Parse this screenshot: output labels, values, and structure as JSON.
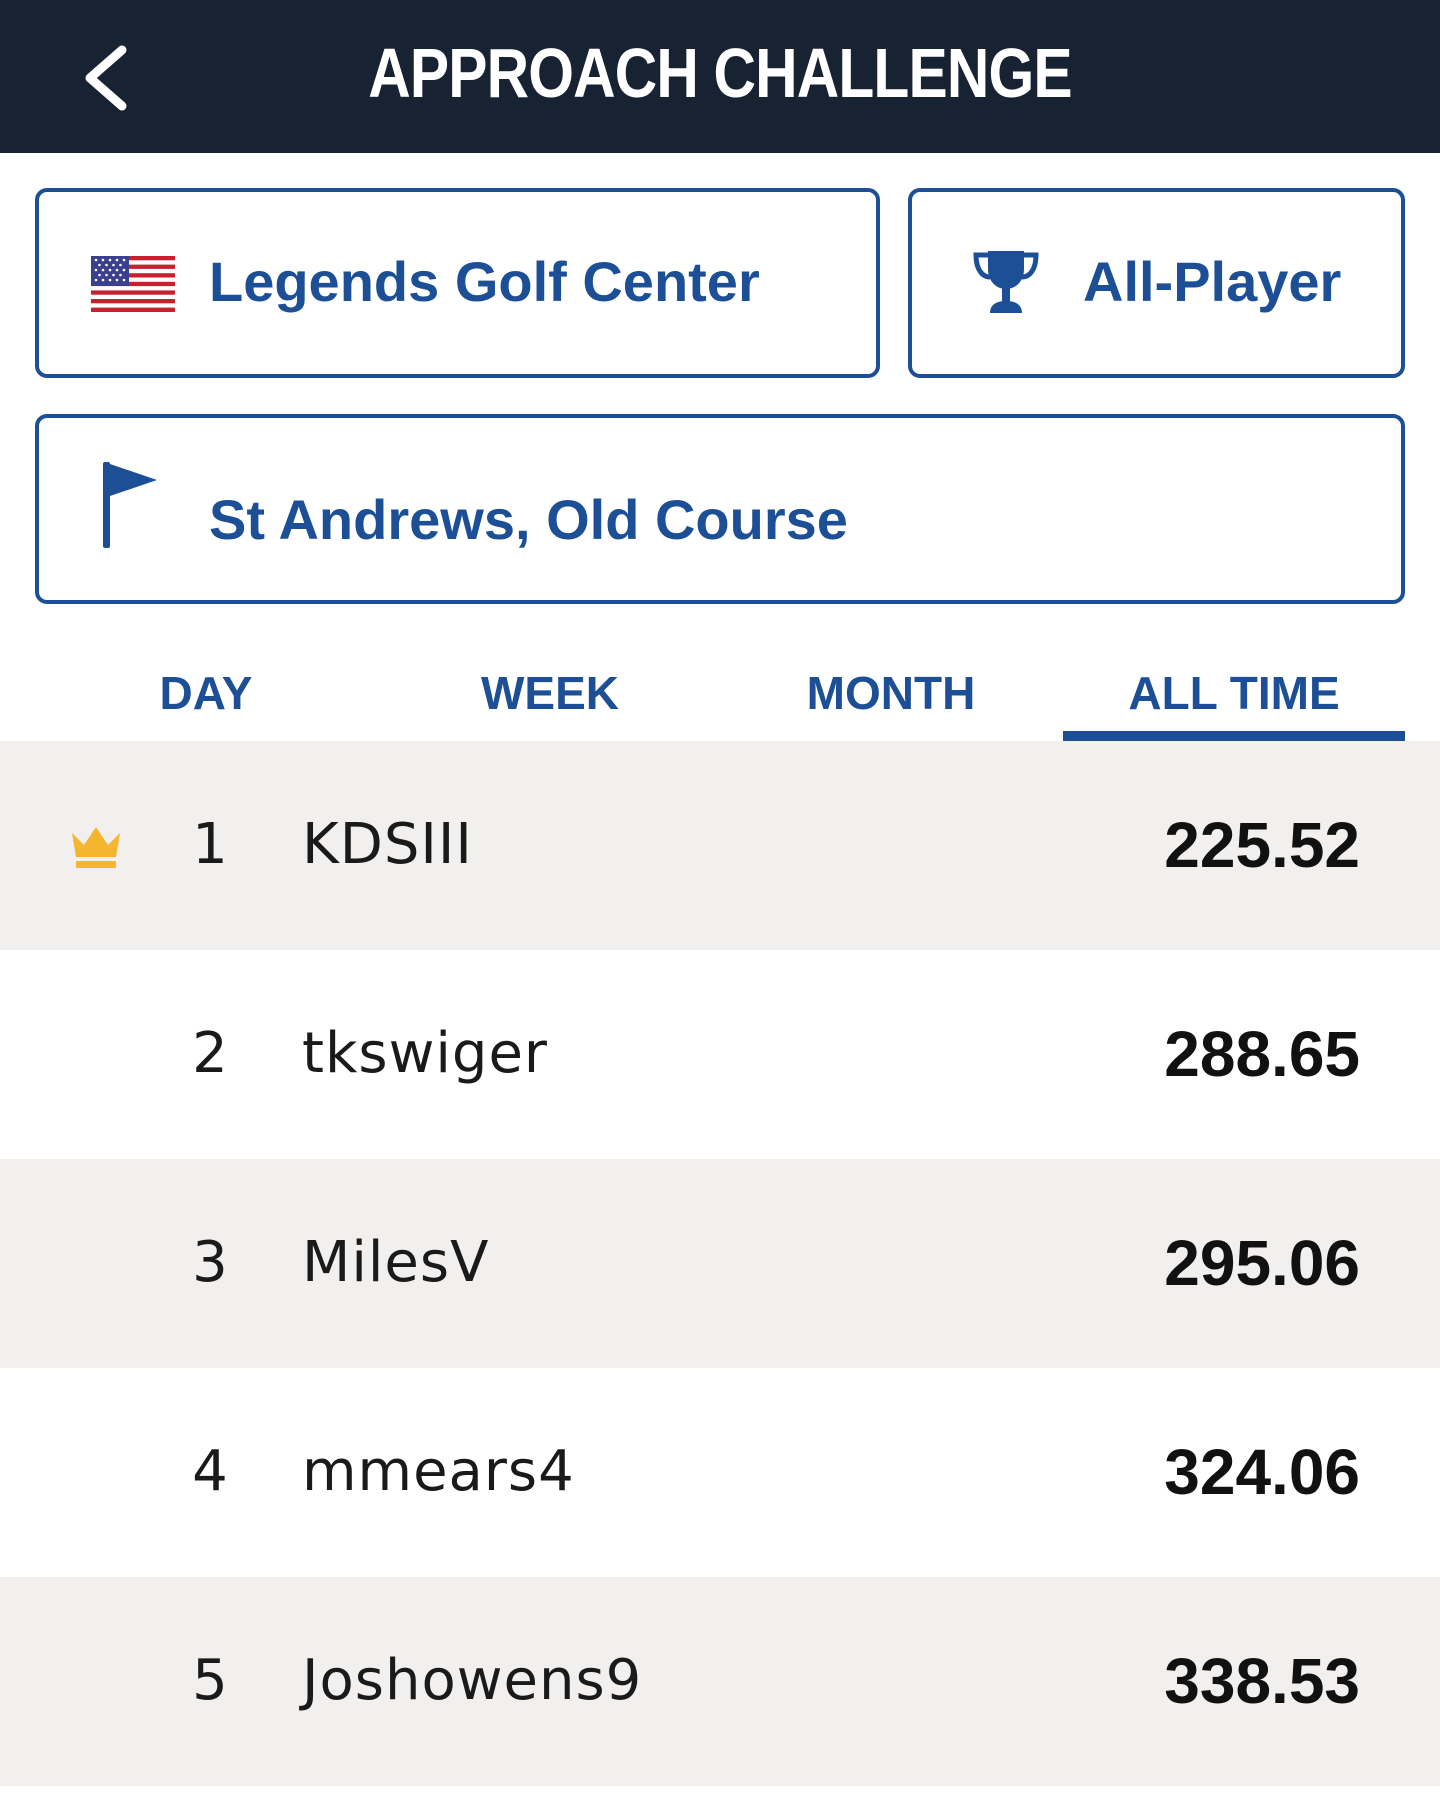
{
  "header": {
    "title": "APPROACH CHALLENGE",
    "back_icon": "chevron-left-icon"
  },
  "filters": {
    "venue": {
      "label": "Legends Golf Center",
      "icon": "us-flag-icon"
    },
    "mode": {
      "label": "All-Player",
      "icon": "trophy-icon"
    },
    "course": {
      "label": "St Andrews, Old Course",
      "icon": "golf-flag-icon"
    }
  },
  "tabs": [
    {
      "label": "DAY",
      "selected": false
    },
    {
      "label": "WEEK",
      "selected": false
    },
    {
      "label": "MONTH",
      "selected": false
    },
    {
      "label": "ALL TIME",
      "selected": true
    }
  ],
  "leaderboard": [
    {
      "rank": "1",
      "player": "KDSIII",
      "score": "225.52",
      "icon": "crown-icon"
    },
    {
      "rank": "2",
      "player": "tkswiger",
      "score": "288.65"
    },
    {
      "rank": "3",
      "player": "MilesV",
      "score": "295.06"
    },
    {
      "rank": "4",
      "player": "mmears4",
      "score": "324.06"
    },
    {
      "rank": "5",
      "player": "Joshowens9",
      "score": "338.53"
    }
  ],
  "colors": {
    "header_bg": "#172233",
    "accent": "#1c4f95",
    "row_shade": "#f1f0ee",
    "crown": "#f3b62e"
  }
}
